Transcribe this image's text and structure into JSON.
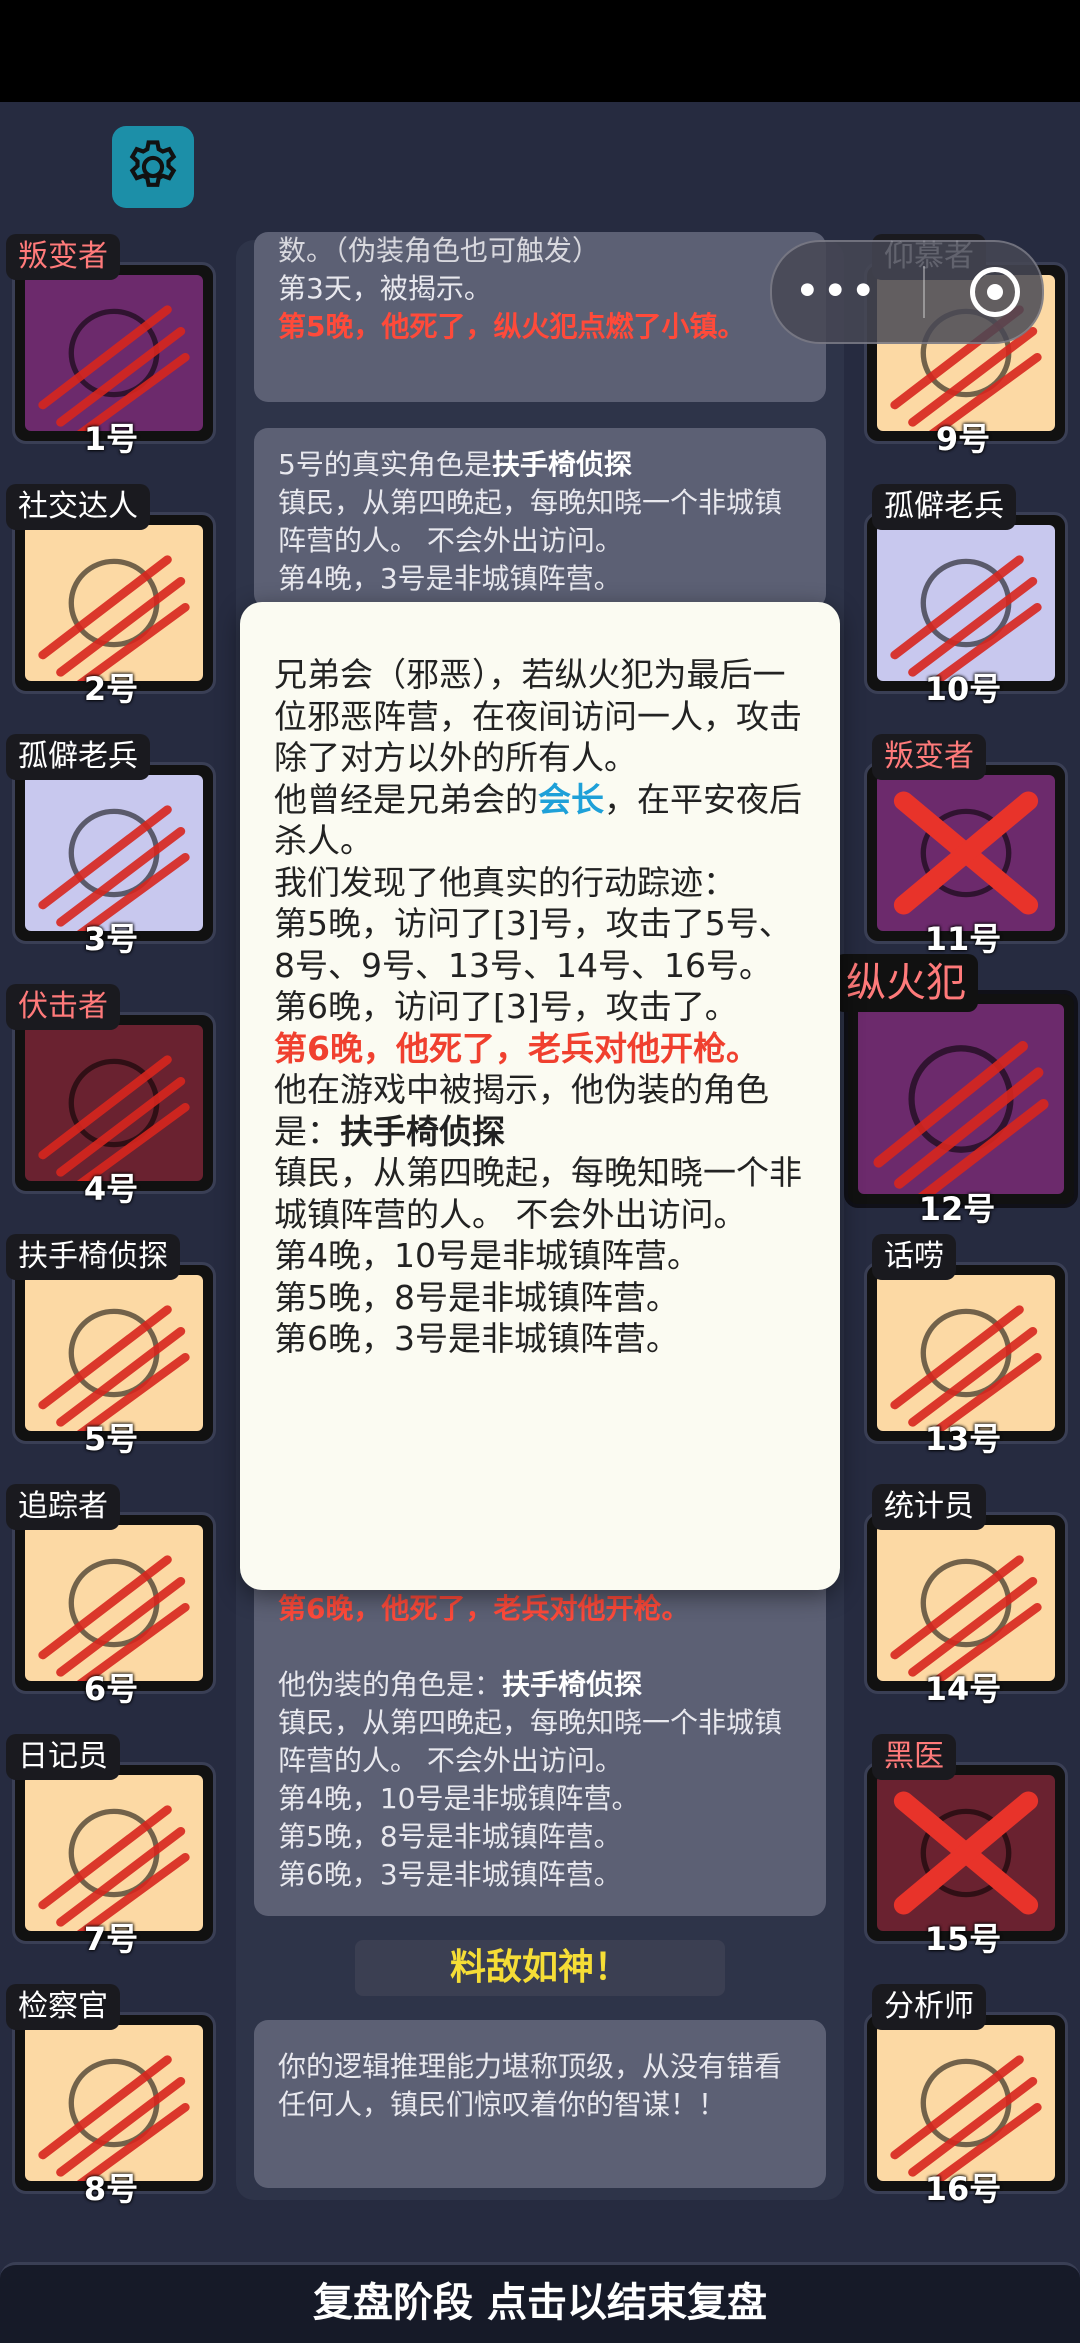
{
  "colors": {
    "background": "#262b40",
    "evil_role": "#ff7a7a",
    "death_text": "#f0402f",
    "highlight": "#1ea0d8",
    "praise": "#f5dd36"
  },
  "settings": {
    "icon": "gear-icon"
  },
  "capsule": {
    "more": "•••",
    "close_icon": "target-icon"
  },
  "players_left": [
    {
      "role": "叛变者",
      "num": "1号",
      "evil": true
    },
    {
      "role": "社交达人",
      "num": "2号",
      "evil": false
    },
    {
      "role": "孤僻老兵",
      "num": "3号",
      "evil": false
    },
    {
      "role": "伏击者",
      "num": "4号",
      "evil": true
    },
    {
      "role": "扶手椅侦探",
      "num": "5号",
      "evil": false
    },
    {
      "role": "追踪者",
      "num": "6号",
      "evil": false
    },
    {
      "role": "日记员",
      "num": "7号",
      "evil": false
    },
    {
      "role": "检察官",
      "num": "8号",
      "evil": false
    }
  ],
  "players_right": [
    {
      "role": "仰慕者",
      "num": "9号",
      "evil": false
    },
    {
      "role": "孤僻老兵",
      "num": "10号",
      "evil": false
    },
    {
      "role": "叛变者",
      "num": "11号",
      "evil": true
    },
    {
      "role": "纵火犯",
      "num": "12号",
      "evil": true
    },
    {
      "role": "话唠",
      "num": "13号",
      "evil": false
    },
    {
      "role": "统计员",
      "num": "14号",
      "evil": false
    },
    {
      "role": "黑医",
      "num": "15号",
      "evil": true
    },
    {
      "role": "分析师",
      "num": "16号",
      "evil": false
    }
  ],
  "log": {
    "card1": {
      "line0": "数。（伪装角色也可触发）",
      "line1": "第3天，被揭示。",
      "death": "第5晚，他死了，纵火犯点燃了小镇。"
    },
    "card2": {
      "intro_a": "5号的真实角色是",
      "intro_role": "扶手椅侦探",
      "desc": "镇民，从第四晚起，每晚知晓一个非城镇阵营的人。 不会外出访问。",
      "n4": "第4晚，3号是非城镇阵营。"
    },
    "card3": {
      "death": "第6晚，他死了，老兵对他开枪。",
      "fake_a": "他伪装的角色是：",
      "fake_role": "扶手椅侦探",
      "desc": "镇民，从第四晚起，每晚知晓一个非城镇阵营的人。 不会外出访问。",
      "n4": "第4晚，10号是非城镇阵营。",
      "n5": "第5晚，8号是非城镇阵营。",
      "n6": "第6晚，3号是非城镇阵营。"
    },
    "praise": "料敌如神！",
    "card4": "你的逻辑推理能力堪称顶级，从没有错看任何人，镇民们惊叹着你的智谋！！"
  },
  "popup": {
    "desc": "兄弟会（邪恶），若纵火犯为最后一位邪恶阵营，在夜间访问一人，攻击除了对方以外的所有人。",
    "past_a": "他曾经是兄弟会的",
    "past_role": "会长",
    "past_b": "，在平安夜后杀人。",
    "trace": "我们发现了他真实的行动踪迹：",
    "n5": "第5晚，访问了[3]号，攻击了5号、8号、9号、13号、14号、16号。",
    "n6": "第6晚，访问了[3]号，攻击了。",
    "death": "第6晚，他死了，老兵对他开枪。",
    "revealed_a": "他在游戏中被揭示，他伪装的角色是：",
    "revealed_role": "扶手椅侦探",
    "role_desc": "镇民，从第四晚起，每晚知晓一个非城镇阵营的人。 不会外出访问。",
    "r4": "第4晚，10号是非城镇阵营。",
    "r5": "第5晚，8号是非城镇阵营。",
    "r6": "第6晚，3号是非城镇阵营。"
  },
  "footer": "复盘阶段 点击以结束复盘"
}
